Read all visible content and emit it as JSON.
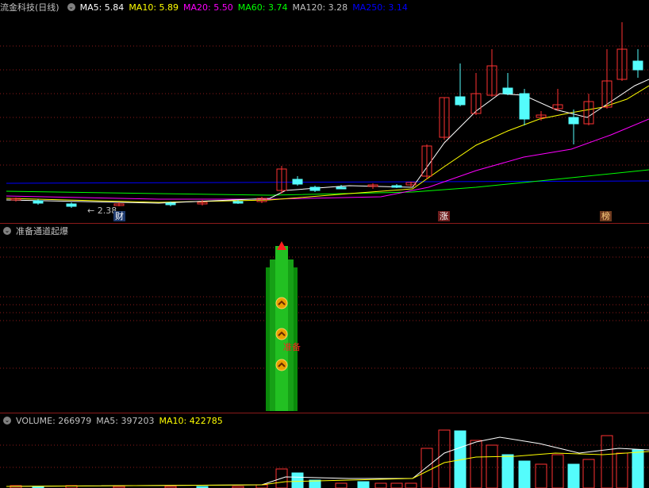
{
  "price_pane": {
    "stock_title": "流金科技(日线)",
    "ma_labels": [
      {
        "text": "MA5: 5.84",
        "color": "#ffffff"
      },
      {
        "text": "MA10: 5.89",
        "color": "#ffff00"
      },
      {
        "text": "MA20: 5.50",
        "color": "#ff00ff"
      },
      {
        "text": "MA60: 3.74",
        "color": "#00ff00"
      },
      {
        "text": "MA120: 3.28",
        "color": "#c0c0c0"
      },
      {
        "text": "MA250: 3.14",
        "color": "#0000ff"
      }
    ],
    "low_marker": "← 2.38",
    "badges": {
      "cai": "财",
      "zhang": "涨",
      "bang": "榜"
    }
  },
  "indicator_pane": {
    "title": "准备通道起爆",
    "signal_text": "准备"
  },
  "volume_pane": {
    "labels": [
      {
        "text": "VOLUME: 266979",
        "color": "#c0c0c0"
      },
      {
        "text": "MA5: 397203",
        "color": "#c0c0c0"
      },
      {
        "text": "MA10: 422785",
        "color": "#ffff00"
      }
    ]
  },
  "colors": {
    "up": "#ff3232",
    "down": "#54fcfc",
    "grid": "#8b1a1a",
    "ma5": "#ffffff",
    "ma10": "#ffff00",
    "ma20": "#ff00ff",
    "ma60": "#00ff00",
    "ma250": "#0000ff"
  }
}
